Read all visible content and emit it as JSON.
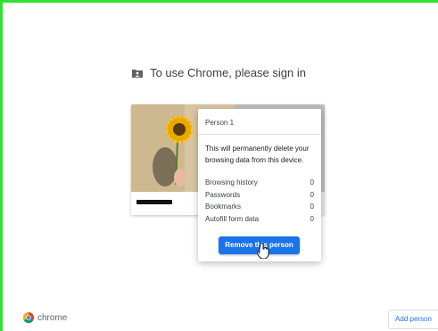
{
  "header": {
    "title": "To use Chrome, please sign in",
    "icon": "profile-folder-icon"
  },
  "profile_card": {
    "photo": "sunflower-photo"
  },
  "popup": {
    "title": "Person 1",
    "message": "This will permanently delete your browsing data from this device.",
    "stats": [
      {
        "label": "Browsing history",
        "value": "0"
      },
      {
        "label": "Passwords",
        "value": "0"
      },
      {
        "label": "Bookmarks",
        "value": "0"
      },
      {
        "label": "Autofill form data",
        "value": "0"
      }
    ],
    "remove_button": "Remove this person"
  },
  "footer": {
    "brand": "chrome",
    "add_person": "Add person"
  },
  "colors": {
    "accent": "#1a73e8",
    "frame": "#2ee32e"
  }
}
